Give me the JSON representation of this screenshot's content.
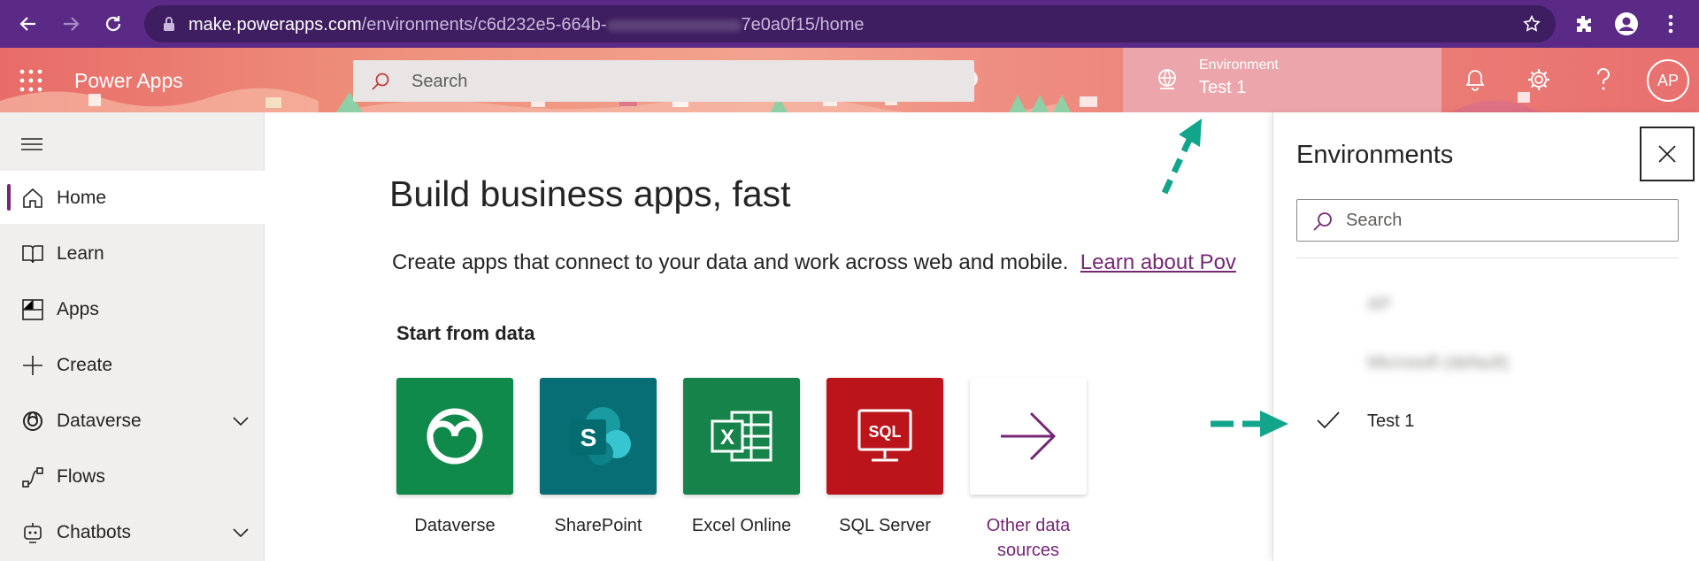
{
  "browser": {
    "url_host": "make.powerapps.com",
    "url_path_start": "/environments/c6d232e5-664b-",
    "url_path_end": "7e0a0f15/home"
  },
  "header": {
    "app_title": "Power Apps",
    "search_placeholder": "Search",
    "environment_label": "Environment",
    "environment_name": "Test 1",
    "avatar_initials": "AP"
  },
  "sidebar": {
    "items": [
      {
        "label": "Home",
        "icon": "home-icon",
        "active": true
      },
      {
        "label": "Learn",
        "icon": "book-icon"
      },
      {
        "label": "Apps",
        "icon": "apps-icon"
      },
      {
        "label": "Create",
        "icon": "plus-icon"
      },
      {
        "label": "Dataverse",
        "icon": "dataverse-icon",
        "expandable": true
      },
      {
        "label": "Flows",
        "icon": "flows-icon"
      },
      {
        "label": "Chatbots",
        "icon": "chatbot-icon",
        "expandable": true
      }
    ]
  },
  "main": {
    "title": "Build business apps, fast",
    "subtitle": "Create apps that connect to your data and work across web and mobile.",
    "learn_link": "Learn about Pov",
    "section_title": "Start from data",
    "tiles": [
      {
        "label": "Dataverse",
        "color": "#108a4a"
      },
      {
        "label": "SharePoint",
        "color": "#066e74"
      },
      {
        "label": "Excel Online",
        "color": "#16844a"
      },
      {
        "label": "SQL Server",
        "color": "#bb151b"
      },
      {
        "label_line1": "Other data",
        "label_line2": "sources",
        "color": "#ffffff"
      }
    ]
  },
  "panel": {
    "title": "Environments",
    "search_placeholder": "Search",
    "items": [
      {
        "label": "AP",
        "blurred": true
      },
      {
        "label": "Microsoft (default)",
        "blurred": true
      },
      {
        "label": "Test 1",
        "selected": true
      }
    ]
  },
  "colors": {
    "browser_bar": "#5b2a86",
    "accent_purple": "#742774",
    "arrow_teal": "#13a58b"
  }
}
